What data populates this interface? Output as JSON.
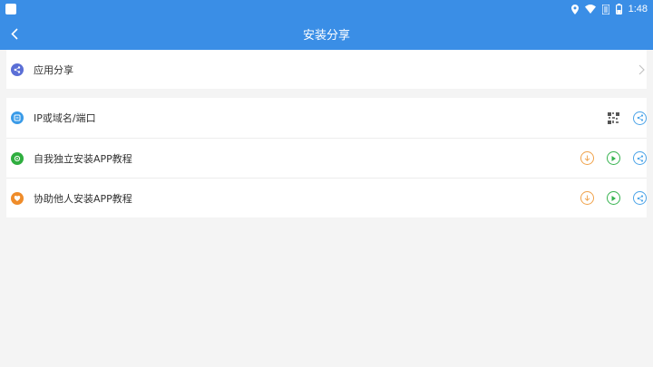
{
  "status_bar": {
    "time": "1:48",
    "icons": [
      "location-icon",
      "wifi-icon",
      "signal-icon",
      "battery-icon"
    ]
  },
  "header": {
    "title": "安装分享",
    "back_icon": "back-arrow-icon"
  },
  "share_section": {
    "label": "应用分享",
    "icon": "share-circle-icon",
    "icon_color": "#5b6fd6"
  },
  "list": {
    "items": [
      {
        "label": "IP或域名/端口",
        "icon": "server-icon",
        "icon_color": "#3a9be8",
        "actions": [
          "qr-code-icon",
          "share-icon"
        ]
      },
      {
        "label": "自我独立安装APP教程",
        "icon": "install-self-icon",
        "icon_color": "#2fae3f",
        "actions": [
          "download-icon",
          "play-icon",
          "share-icon"
        ]
      },
      {
        "label": "协助他人安装APP教程",
        "icon": "install-assist-icon",
        "icon_color": "#ef8c2a",
        "actions": [
          "download-icon",
          "play-icon",
          "share-icon"
        ]
      }
    ]
  },
  "colors": {
    "primary": "#3a8ee6",
    "download": "#f0a24a",
    "play": "#36b34f",
    "share": "#4aa3e8"
  }
}
